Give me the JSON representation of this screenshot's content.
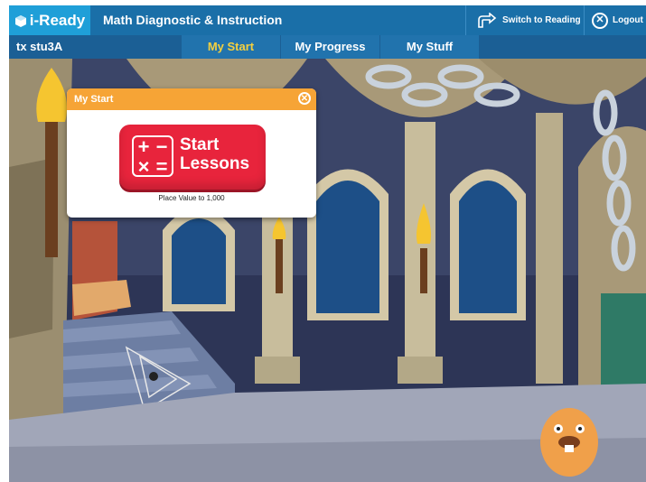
{
  "header": {
    "logo_text": "i-Ready",
    "app_title": "Math Diagnostic & Instruction",
    "switch_label": "Switch to Reading",
    "logout_label": "Logout"
  },
  "nav": {
    "user": "tx stu3A",
    "tabs": [
      {
        "label": "My Start",
        "active": true
      },
      {
        "label": "My Progress",
        "active": false
      },
      {
        "label": "My Stuff",
        "active": false
      }
    ]
  },
  "popup": {
    "title": "My Start",
    "start_line1": "Start",
    "start_line2": "Lessons",
    "ops_symbols": [
      "+",
      "−",
      "×",
      "="
    ],
    "lesson_caption": "Place Value to 1,000"
  },
  "colors": {
    "header_blue": "#1a6fa8",
    "logo_blue": "#1f9fd8",
    "tab_blue": "#2173ad",
    "active_tab_text": "#f4d03f",
    "popup_orange": "#f6a436",
    "start_red": "#e8243c",
    "castle_night": "#2d3556"
  },
  "icons": {
    "logo": "i-ready-cube-icon",
    "switch": "switch-arrow-icon",
    "logout": "close-circle-icon",
    "popup_close": "close-circle-icon"
  }
}
